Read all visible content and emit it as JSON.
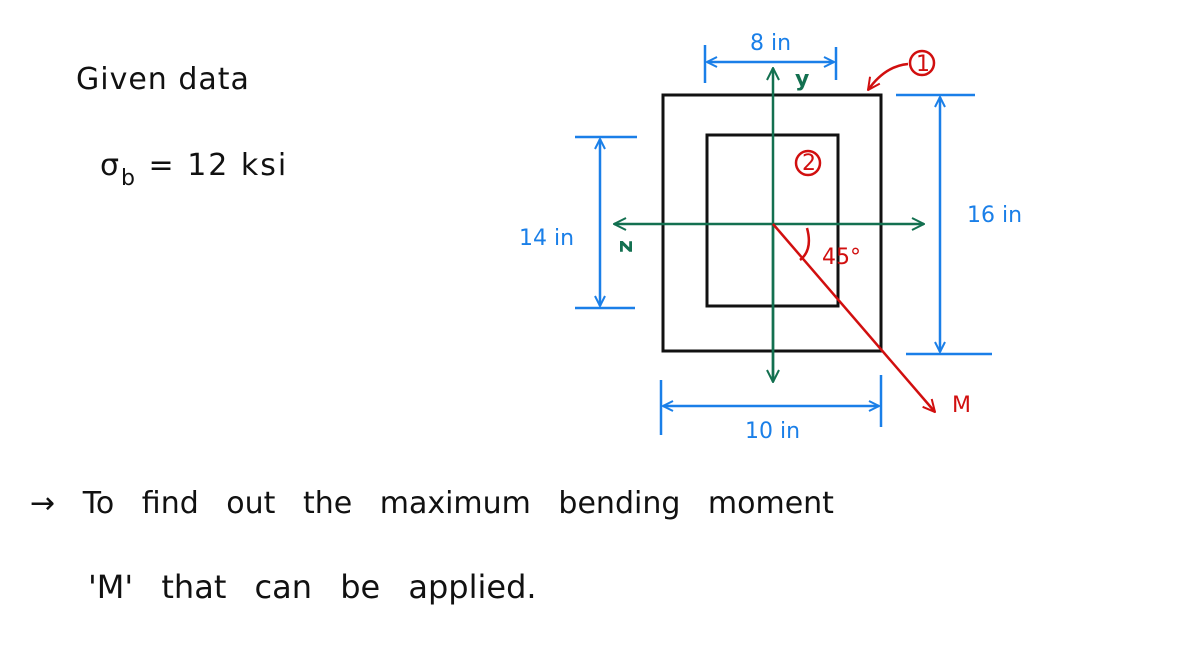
{
  "given": {
    "title": "Given data",
    "stress_symbol": "σ",
    "stress_subscript": "b",
    "stress_value": "= 12 ksi"
  },
  "diagram": {
    "dims": {
      "top_width": "8 in",
      "bottom_width": "10 in",
      "left_height": "14 in",
      "right_height": "16 in"
    },
    "axes": {
      "y_label": "y",
      "z_label": "z"
    },
    "regions": {
      "outer_label": "1",
      "inner_label": "2"
    },
    "moment": {
      "label": "M",
      "angle_label": "45°"
    },
    "colors": {
      "dimension": "#1a7fe8",
      "axis": "#137050",
      "moment": "#d10f0f",
      "section": "#111111"
    }
  },
  "goal": {
    "arrow": "→",
    "line1": "To find out the maximum bending moment",
    "line2": "'M' that can be applied."
  }
}
